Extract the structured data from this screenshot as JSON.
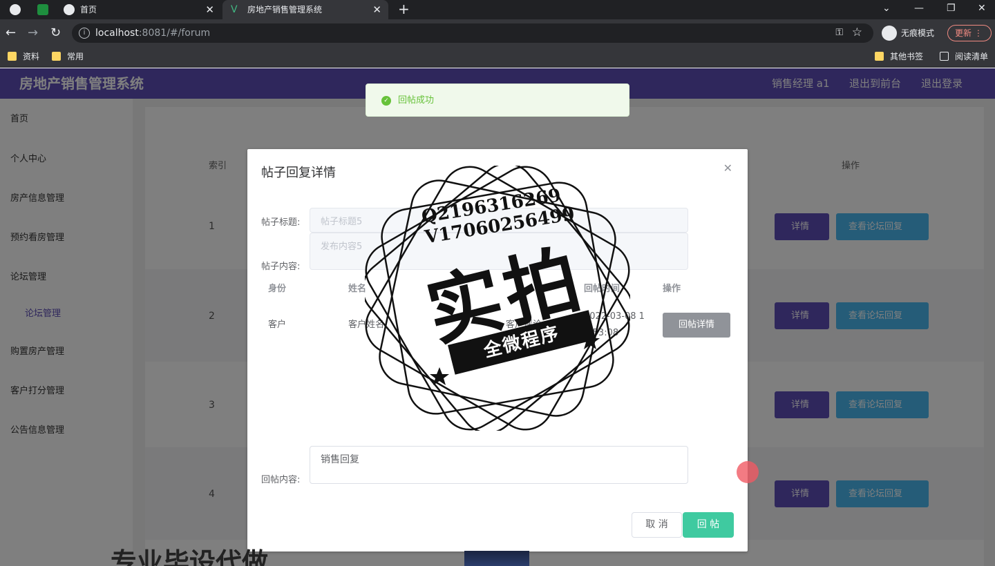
{
  "browser": {
    "tabs": [
      {
        "label": "首页"
      },
      {
        "label": "房地产销售管理系统"
      }
    ],
    "url_host": "localhost",
    "url_rest": ":8081/#/forum",
    "incognito_label": "无痕模式",
    "update_label": "更新",
    "bookmarks": [
      {
        "label": "资料"
      },
      {
        "label": "常用"
      }
    ],
    "other_bookmarks": "其他书签",
    "reading_list": "阅读清单"
  },
  "app": {
    "title": "房地产销售管理系统",
    "user": "销售经理 a1",
    "exit_front": "退出到前台",
    "logout": "退出登录"
  },
  "sidebar": {
    "items": [
      {
        "label": "首页"
      },
      {
        "label": "个人中心"
      },
      {
        "label": "房产信息管理"
      },
      {
        "label": "预约看房管理"
      },
      {
        "label": "论坛管理"
      },
      {
        "label": "论坛管理"
      },
      {
        "label": "购置房产管理"
      },
      {
        "label": "客户打分管理"
      },
      {
        "label": "公告信息管理"
      }
    ]
  },
  "table": {
    "col_index": "索引",
    "col_actions": "操作",
    "rows": [
      {
        "index": "1"
      },
      {
        "index": "2"
      },
      {
        "index": "3"
      },
      {
        "index": "4"
      }
    ],
    "detail_label": "详情",
    "view_replies_label": "查看论坛回复"
  },
  "toast": {
    "message": "回帖成功"
  },
  "dialog": {
    "title": "帖子回复详情",
    "post_title_label": "帖子标题:",
    "post_title_value": "帖子标题5",
    "post_content_label": "帖子内容:",
    "post_content_value": "发布内容5",
    "headers": {
      "identity": "身份",
      "name": "姓名",
      "time": "回帖时间",
      "actions": "操作"
    },
    "reply_row": {
      "identity": "客户",
      "name": "客户姓名",
      "comment": "客户评论",
      "time_line1": "2022-03-08 1",
      "time_line2": "9:53:08",
      "action": "回帖详情"
    },
    "reply_content_label": "回帖内容:",
    "reply_content_value": "销售回复",
    "cancel_label": "取 消",
    "submit_label": "回 帖"
  },
  "watermark": {
    "line1": "Q2196316269",
    "line2": "V17060256499",
    "big": "实拍",
    "banner": "全微程序"
  },
  "bottom_caption": "专业毕设代做"
}
